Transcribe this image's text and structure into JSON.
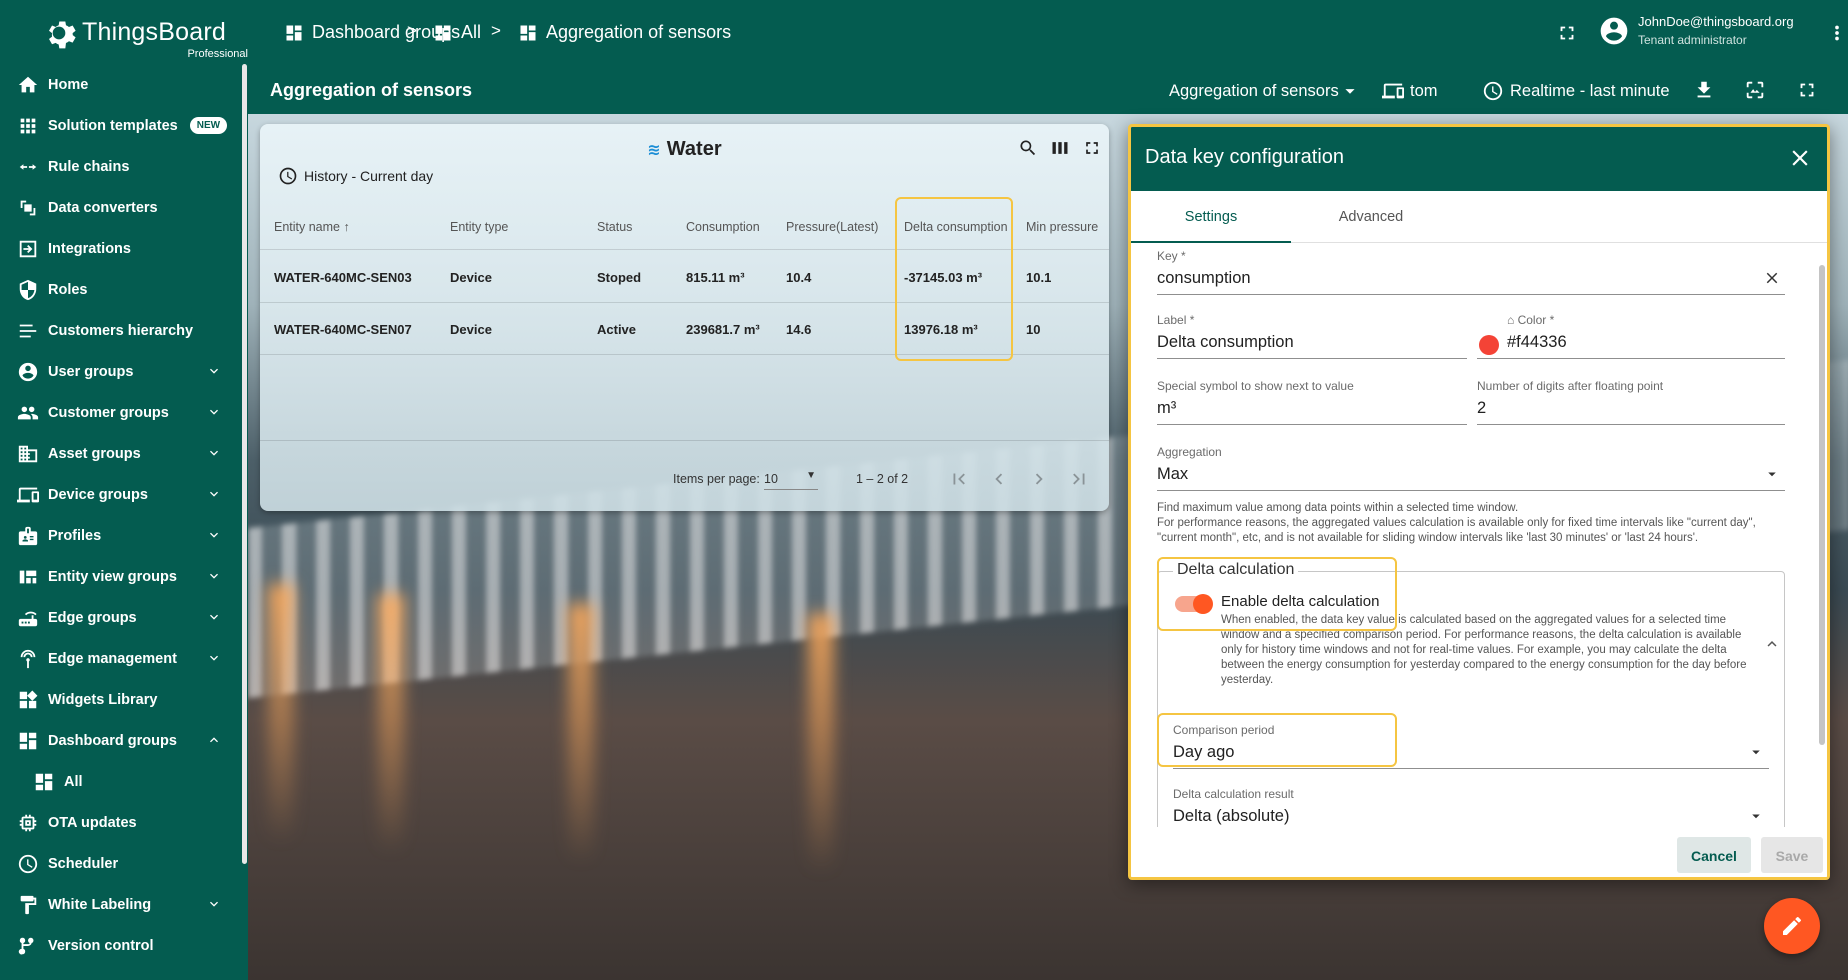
{
  "brand": {
    "name": "ThingsBoard",
    "edition": "Professional"
  },
  "breadcrumb": [
    {
      "label": "Dashboard groups",
      "icon": "dashboard-grid-icon"
    },
    {
      "label": "All",
      "icon": "dashboard-grid-icon"
    },
    {
      "label": "Aggregation of sensors",
      "icon": "dashboard-grid-icon"
    }
  ],
  "breadcrumb_sep": ">",
  "user": {
    "email": "JohnDoe@thingsboard.org",
    "role": "Tenant administrator"
  },
  "sidebar": {
    "items": [
      {
        "label": "Home",
        "icon": "home-icon"
      },
      {
        "label": "Solution templates",
        "icon": "apps-icon",
        "badge": "NEW"
      },
      {
        "label": "Rule chains",
        "icon": "rule-chain-icon"
      },
      {
        "label": "Data converters",
        "icon": "converter-icon"
      },
      {
        "label": "Integrations",
        "icon": "integration-icon"
      },
      {
        "label": "Roles",
        "icon": "shield-icon"
      },
      {
        "label": "Customers hierarchy",
        "icon": "hierarchy-icon"
      },
      {
        "label": "User groups",
        "icon": "account-circle-icon",
        "expandable": true
      },
      {
        "label": "Customer groups",
        "icon": "people-icon",
        "expandable": true
      },
      {
        "label": "Asset groups",
        "icon": "domain-icon",
        "expandable": true
      },
      {
        "label": "Device groups",
        "icon": "devices-icon",
        "expandable": true
      },
      {
        "label": "Profiles",
        "icon": "profile-icon",
        "expandable": true
      },
      {
        "label": "Entity view groups",
        "icon": "view-quilt-icon",
        "expandable": true
      },
      {
        "label": "Edge groups",
        "icon": "router-icon",
        "expandable": true
      },
      {
        "label": "Edge management",
        "icon": "antenna-icon",
        "expandable": true
      },
      {
        "label": "Widgets Library",
        "icon": "widgets-icon"
      },
      {
        "label": "Dashboard groups",
        "icon": "dashboard-grid-icon",
        "expandable": true,
        "expanded": true
      },
      {
        "label": "All",
        "icon": "dashboard-grid-icon",
        "sub": true
      },
      {
        "label": "OTA updates",
        "icon": "memory-icon"
      },
      {
        "label": "Scheduler",
        "icon": "clock-icon"
      },
      {
        "label": "White Labeling",
        "icon": "format-paint-icon",
        "expandable": true
      },
      {
        "label": "Version control",
        "icon": "git-icon"
      }
    ]
  },
  "dashboard_bar": {
    "title": "Aggregation of sensors",
    "state_select": "Aggregation of sensors",
    "entity_alias": "tom",
    "timewindow": "Realtime - last minute"
  },
  "widget": {
    "title": "Water",
    "history": "History - Current day",
    "columns": [
      "Entity name",
      "Entity type",
      "Status",
      "Consumption",
      "Pressure(Latest)",
      "Delta consumption",
      "Min pressure"
    ],
    "rows": [
      [
        "WATER-640MC-SEN03",
        "Device",
        "Stoped",
        "815.11 m³",
        "10.4",
        "-37145.03 m³",
        "10.1"
      ],
      [
        "WATER-640MC-SEN07",
        "Device",
        "Active",
        "239681.7 m³",
        "14.6",
        "13976.18 m³",
        "10"
      ]
    ],
    "pager": {
      "items_per_page_label": "Items per page:",
      "items_per_page": "10",
      "range": "1 – 2 of 2"
    }
  },
  "dialog": {
    "title": "Data key configuration",
    "tabs": [
      "Settings",
      "Advanced"
    ],
    "key": {
      "label": "Key *",
      "value": "consumption"
    },
    "label_field": {
      "label": "Label *",
      "value": "Delta consumption"
    },
    "color": {
      "label": "Color *",
      "value": "#f44336"
    },
    "units": {
      "label": "Special symbol to show next to value",
      "value": "m³"
    },
    "decimals": {
      "label": "Number of digits after floating point",
      "value": "2"
    },
    "aggregation": {
      "label": "Aggregation",
      "value": "Max",
      "hint1": "Find maximum value among data points within a selected time window.",
      "hint2": "For performance reasons, the aggregated values calculation is available only for fixed time intervals like \"current day\", \"current month\", etc, and is not available for sliding window intervals like 'last 30 minutes' or 'last 24 hours'."
    },
    "delta": {
      "legend": "Delta calculation",
      "toggle_label": "Enable delta calculation",
      "description": "When enabled, the data key value is calculated based on the aggregated values for a selected time window and a specified comparison period. For performance reasons, the delta calculation is available only for history time windows and not for real-time values. For example, you may calculate the delta between the energy consumption for yesterday compared to the energy consumption for the day before yesterday.",
      "comparison": {
        "label": "Comparison period",
        "value": "Day ago"
      },
      "result": {
        "label": "Delta calculation result",
        "value": "Delta (absolute)"
      }
    },
    "buttons": {
      "cancel": "Cancel",
      "save": "Save"
    }
  },
  "colors": {
    "primary": "#045c50",
    "accent": "#ff5722",
    "highlight": "#f5c542",
    "series_color": "#f44336"
  }
}
